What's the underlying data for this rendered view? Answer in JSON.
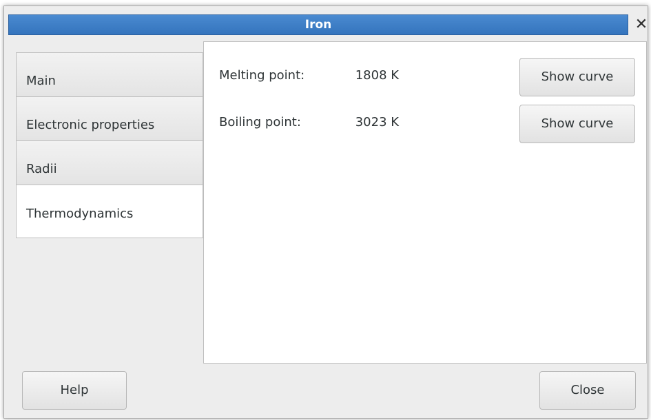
{
  "window": {
    "title": "Iron"
  },
  "tabs": [
    {
      "label": "Main"
    },
    {
      "label": "Electronic properties"
    },
    {
      "label": "Radii"
    },
    {
      "label": "Thermodynamics"
    }
  ],
  "active_tab": "Thermodynamics",
  "properties": [
    {
      "label": "Melting point:",
      "value": "1808 K",
      "button": "Show curve"
    },
    {
      "label": "Boiling point:",
      "value": "3023 K",
      "button": "Show curve"
    }
  ],
  "footer": {
    "help_label": "Help",
    "close_label": "Close"
  },
  "colors": {
    "titlebar": "#3f80c8",
    "panel_bg": "#ffffff",
    "window_bg": "#ededed"
  },
  "icons": {
    "window_close": "close-icon"
  }
}
